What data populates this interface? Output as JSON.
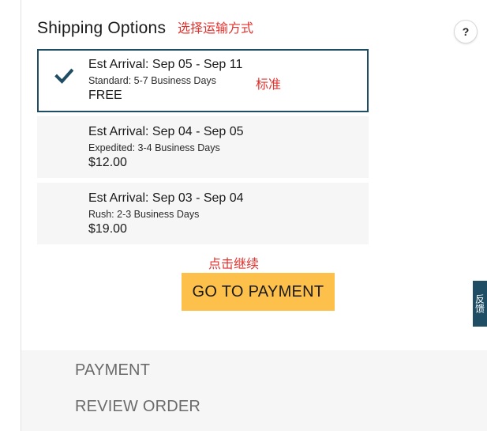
{
  "shipping": {
    "title": "Shipping Options",
    "help_label": "?",
    "options": [
      {
        "arrival": "Est Arrival: Sep 05 - Sep 11",
        "method": "Standard: 5-7 Business Days",
        "price": "FREE",
        "selected": true
      },
      {
        "arrival": "Est Arrival: Sep 04 - Sep 05",
        "method": "Expedited: 3-4 Business Days",
        "price": "$12.00",
        "selected": false
      },
      {
        "arrival": "Est Arrival: Sep 03 - Sep 04",
        "method": "Rush: 2-3 Business Days",
        "price": "$19.00",
        "selected": false
      }
    ],
    "pay_button": "GO TO PAYMENT"
  },
  "annotations": {
    "title_note": "选择运输方式",
    "standard_note": "标准",
    "continue_note": "点击继续"
  },
  "side_tab": {
    "label": "反馈"
  },
  "steps": [
    {
      "label": "PAYMENT"
    },
    {
      "label": "REVIEW ORDER"
    }
  ],
  "icons": {
    "selected_option": "checkmark-icon"
  },
  "colors": {
    "accent": "#1f4e64",
    "pay_button": "#fcc04b",
    "annotation": "#e0332f",
    "option_background": "#f6f6f6"
  }
}
